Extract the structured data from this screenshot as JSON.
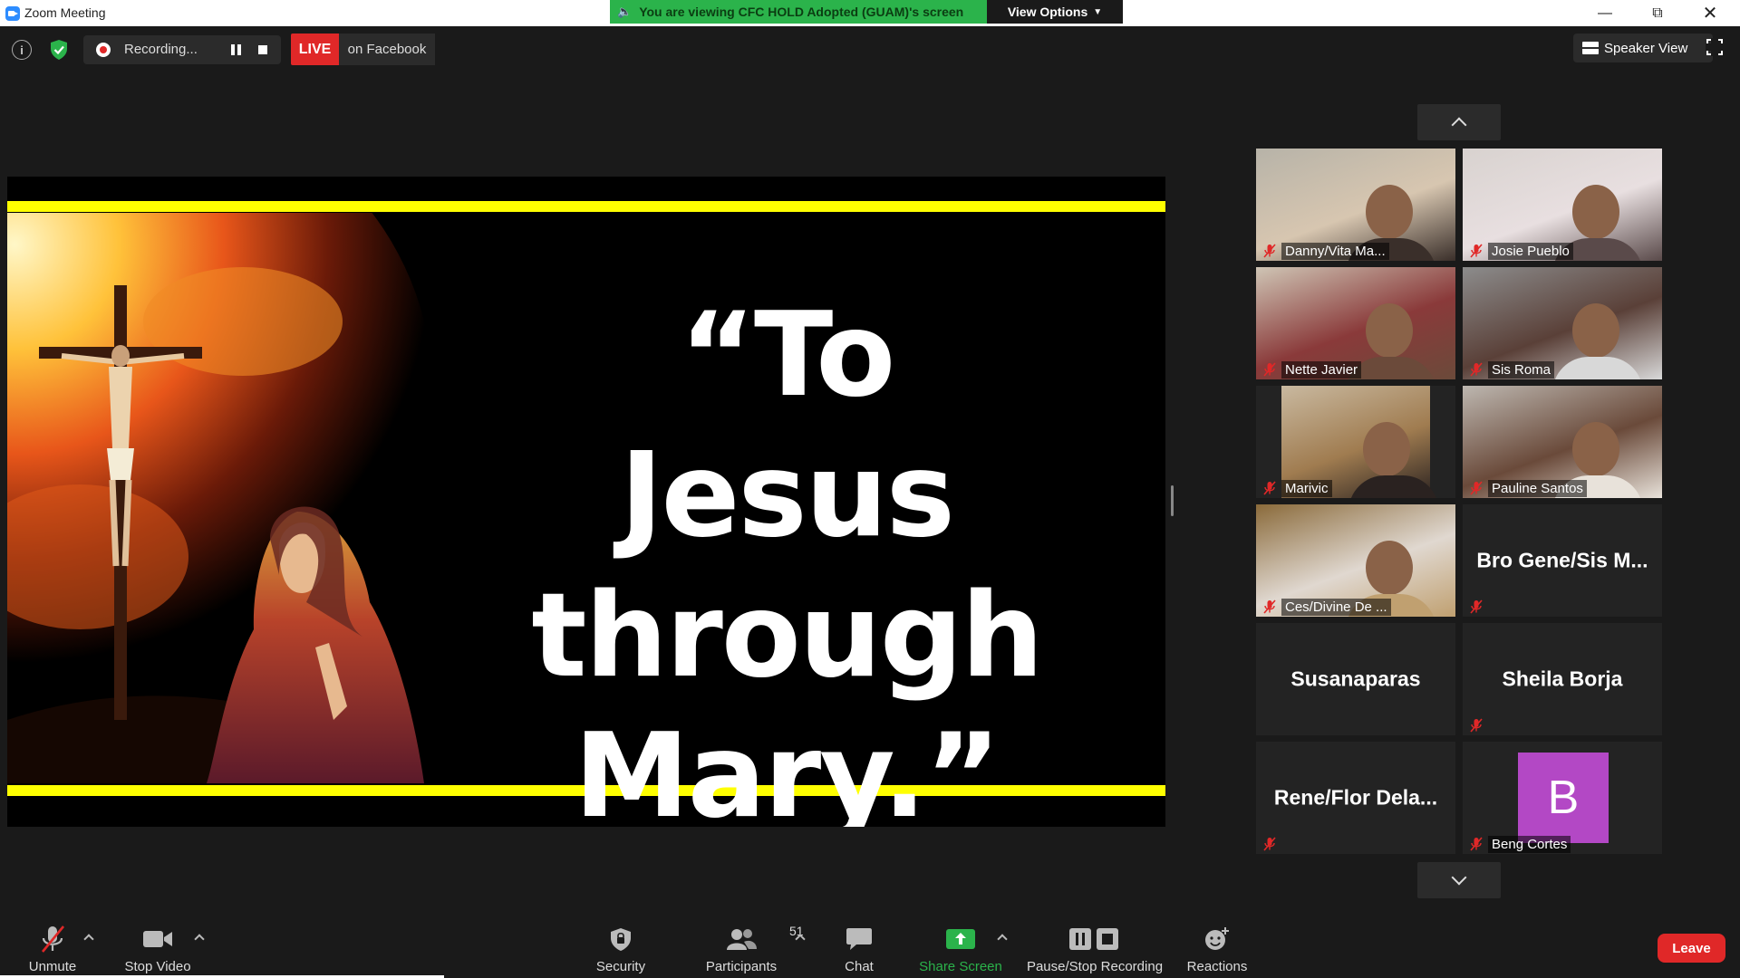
{
  "window": {
    "title": "Zoom Meeting"
  },
  "banner": {
    "viewing_text": "You are viewing CFC HOLD Adopted (GUAM)'s screen",
    "view_options": "View Options"
  },
  "meeting_bar": {
    "recording_text": "Recording...",
    "live_label": "LIVE",
    "live_destination": "on Facebook",
    "speaker_view": "Speaker View"
  },
  "slide": {
    "line1": "“To Jesus",
    "line2": "through",
    "line3": "Mary.”"
  },
  "participants_gallery": [
    {
      "name": "Danny/Vita Ma...",
      "has_video": true,
      "muted": true
    },
    {
      "name": "Josie  Pueblo",
      "has_video": true,
      "muted": true
    },
    {
      "name": "Nette Javier",
      "has_video": true,
      "muted": true
    },
    {
      "name": "Sis Roma",
      "has_video": true,
      "muted": true
    },
    {
      "name": "Marivic",
      "has_video": true,
      "muted": true
    },
    {
      "name": "Pauline Santos",
      "has_video": true,
      "muted": true
    },
    {
      "name": "Ces/Divine De ...",
      "has_video": true,
      "muted": true
    },
    {
      "name": "Bro Gene/Sis M...",
      "has_video": false,
      "muted": true
    },
    {
      "name": "Susanaparas",
      "has_video": false,
      "muted": false
    },
    {
      "name": "Sheila Borja",
      "has_video": false,
      "muted": true
    },
    {
      "name": "Rene/Flor  Dela...",
      "has_video": false,
      "muted": true
    },
    {
      "name": "Beng Cortes",
      "has_video": false,
      "muted": true,
      "avatar_letter": "B",
      "avatar_color": "#b348c5"
    }
  ],
  "toolbar": {
    "unmute": "Unmute",
    "stop_video": "Stop Video",
    "security": "Security",
    "participants": "Participants",
    "participants_count": "51",
    "chat": "Chat",
    "share_screen": "Share Screen",
    "pause_stop_recording": "Pause/Stop Recording",
    "reactions": "Reactions",
    "leave": "Leave"
  },
  "colors": {
    "live_red": "#e02828",
    "share_green": "#2bb34b",
    "banner_green": "#2bb34b",
    "slide_yellow": "#ffff00",
    "avatar_purple": "#b348c5"
  }
}
